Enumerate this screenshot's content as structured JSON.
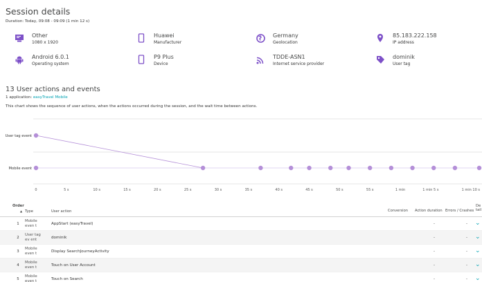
{
  "session": {
    "title": "Session details",
    "duration": "Duration: Today, 09:08 - 09:09 (1 min 12 s)"
  },
  "info": [
    {
      "icon": "monitor-icon",
      "value": "Other",
      "label": "1080 x 1920"
    },
    {
      "icon": "smartphone-icon",
      "value": "Huawei",
      "label": "Manufacturer"
    },
    {
      "icon": "globe-icon",
      "value": "Germany",
      "label": "Geolocation"
    },
    {
      "icon": "location-pin-icon",
      "value": "85.183.222.158",
      "label": "IP address"
    },
    {
      "icon": "android-icon",
      "value": "Android 6.0.1",
      "label": "Operating system"
    },
    {
      "icon": "smartphone-icon",
      "value": "P9 Plus",
      "label": "Device"
    },
    {
      "icon": "wifi-signal-icon",
      "value": "TDDE-ASN1",
      "label": "Internet service provider"
    },
    {
      "icon": "tag-icon",
      "value": "dominik",
      "label": "User tag"
    }
  ],
  "actions": {
    "heading": "13 User actions and events",
    "app_prefix": "1 application: ",
    "app_link": "easyTravel Mobile",
    "description": "This chart shows the sequence of user actions, when the actions occurred during the session, and the wait time between actions."
  },
  "chart_data": {
    "type": "scatter",
    "y_categories": [
      "User tag event",
      "Mobile event"
    ],
    "x_ticks": [
      "0",
      "5 s",
      "10 s",
      "15 s",
      "20 s",
      "25 s",
      "30 s",
      "35 s",
      "40 s",
      "45 s",
      "50 s",
      "55 s",
      "1 min",
      "1 min 5 s",
      "1 min 10 s"
    ],
    "xlim": [
      0,
      73
    ],
    "points": [
      {
        "x": 0,
        "y": "User tag event"
      },
      {
        "x": 0,
        "y": "Mobile event"
      },
      {
        "x": 27.5,
        "y": "Mobile event"
      },
      {
        "x": 37,
        "y": "Mobile event"
      },
      {
        "x": 42,
        "y": "Mobile event"
      },
      {
        "x": 45,
        "y": "Mobile event"
      },
      {
        "x": 48.5,
        "y": "Mobile event"
      },
      {
        "x": 51.5,
        "y": "Mobile event"
      },
      {
        "x": 55,
        "y": "Mobile event"
      },
      {
        "x": 58.5,
        "y": "Mobile event"
      },
      {
        "x": 62,
        "y": "Mobile event"
      },
      {
        "x": 65.5,
        "y": "Mobile event"
      },
      {
        "x": 69,
        "y": "Mobile event"
      },
      {
        "x": 73,
        "y": "Mobile event"
      }
    ],
    "connector": [
      {
        "x": 0,
        "y": "User tag event"
      },
      {
        "x": 27.5,
        "y": "Mobile event"
      }
    ],
    "grid": true,
    "color": "#b48fd8"
  },
  "table": {
    "headers": {
      "order": "Order",
      "type": "Type",
      "action": "User action",
      "conversion": "Conversion",
      "duration": "Action duration",
      "errors": "Errors / Crashes",
      "details": "De tail"
    },
    "rows": [
      {
        "num": "1",
        "type": "Mobile even t",
        "action": "AppStart (easyTravel)",
        "duration": "-",
        "errors": "-"
      },
      {
        "num": "2",
        "type": "User tag ev ent",
        "action": "dominik",
        "duration": "-",
        "errors": "-"
      },
      {
        "num": "3",
        "type": "Mobile even t",
        "action": "Display SearchJourneyActivity",
        "duration": "-",
        "errors": "-"
      },
      {
        "num": "4",
        "type": "Mobile even t",
        "action": "Touch on User Account",
        "duration": "-",
        "errors": "-"
      },
      {
        "num": "5",
        "type": "Mobile even t",
        "action": "Touch on Search",
        "duration": "-",
        "errors": "-"
      }
    ]
  }
}
